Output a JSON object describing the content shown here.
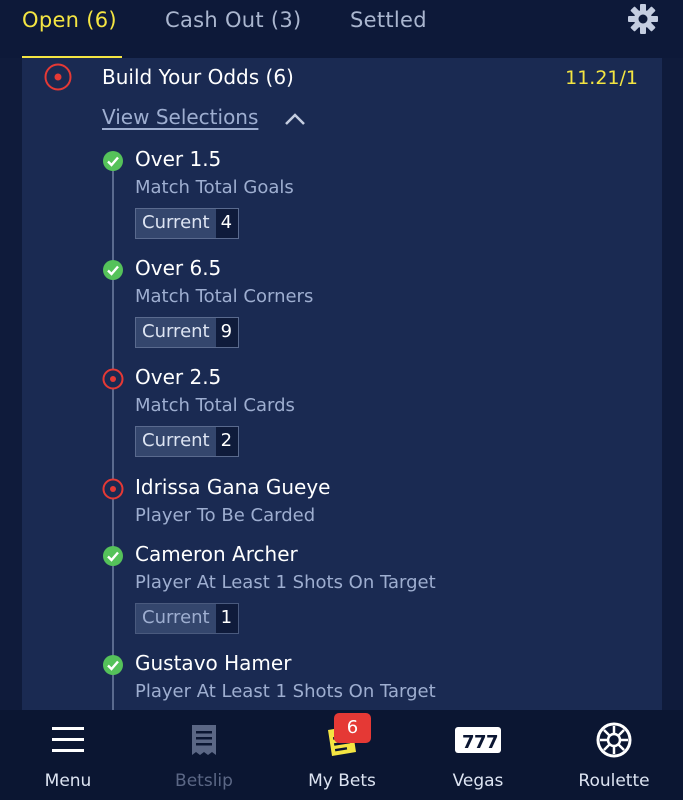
{
  "tabs": [
    {
      "label": "Open (6)",
      "active": true
    },
    {
      "label": "Cash Out (3)",
      "active": false
    },
    {
      "label": "Settled",
      "active": false
    }
  ],
  "settings_icon": "gear-icon",
  "bet": {
    "title": "Build Your Odds (6)",
    "odds": "11.21/1",
    "status_icon": "target-icon",
    "view_selections_label": "View Selections",
    "selections": [
      {
        "name": "Over 1.5",
        "market": "Match Total Goals",
        "status": "won",
        "current_label": "Current",
        "current_value": "4"
      },
      {
        "name": "Over 6.5",
        "market": "Match Total Corners",
        "status": "won",
        "current_label": "Current",
        "current_value": "9"
      },
      {
        "name": "Over 2.5",
        "market": "Match Total Cards",
        "status": "pending",
        "current_label": "Current",
        "current_value": "2"
      },
      {
        "name": "Idrissa Gana Gueye",
        "market": "Player To Be Carded",
        "status": "pending"
      },
      {
        "name": "Cameron Archer",
        "market": "Player At Least 1 Shots On Target",
        "status": "won",
        "current_label": "Current",
        "current_value": "1"
      },
      {
        "name": "Gustavo Hamer",
        "market": "Player At Least 1 Shots On Target",
        "status": "won"
      }
    ]
  },
  "bottom_nav": [
    {
      "label": "Menu",
      "icon": "hamburger-icon",
      "disabled": false
    },
    {
      "label": "Betslip",
      "icon": "receipt-icon",
      "disabled": true
    },
    {
      "label": "My Bets",
      "icon": "ticket-icon",
      "disabled": false,
      "badge": "6"
    },
    {
      "label": "Vegas",
      "icon": "slot-777-icon",
      "disabled": false
    },
    {
      "label": "Roulette",
      "icon": "roulette-wheel-icon",
      "disabled": false
    }
  ],
  "colors": {
    "accent": "#f4e542",
    "won": "#55c25a",
    "pending": "#e53935",
    "card": "#1a2a52",
    "background": "#0f1b3b"
  }
}
